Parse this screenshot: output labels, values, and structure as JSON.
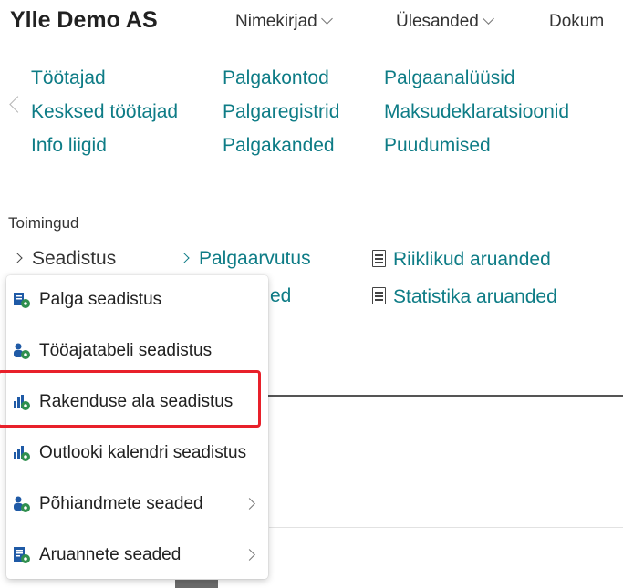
{
  "header": {
    "company": "Ylle Demo AS",
    "menus": [
      "Nimekirjad",
      "Ülesanded",
      "Dokum"
    ]
  },
  "navlinks": {
    "col1": [
      "Töötajad",
      "Kesksed töötajad",
      "Info liigid"
    ],
    "col2": [
      "Palgakontod",
      "Palgaregistrid",
      "Palgakanded"
    ],
    "col3": [
      "Palgaanalüüsid",
      "Maksudeklaratsioonid",
      "Puudumised"
    ]
  },
  "actions": {
    "section_label": "Toimingud",
    "seadistus": "Seadistus",
    "palgaarvutus": "Palgaarvutus",
    "partial": "ed",
    "riiklikud": "Riiklikud aruanded",
    "statistika": "Statistika aruanded"
  },
  "dropdown": {
    "items": [
      {
        "label": "Palga seadistus"
      },
      {
        "label": "Tööajatabeli seadistus"
      },
      {
        "label": "Rakenduse ala seadistus"
      },
      {
        "label": "Outlooki kalendri seadistus"
      },
      {
        "label": "Põhiandmete seaded"
      },
      {
        "label": "Aruannete seaded"
      }
    ]
  },
  "colors": {
    "link": "#0e7c86",
    "highlight": "#e8202a",
    "icon_blue": "#1f5aa6",
    "icon_green": "#2f8f4e"
  }
}
